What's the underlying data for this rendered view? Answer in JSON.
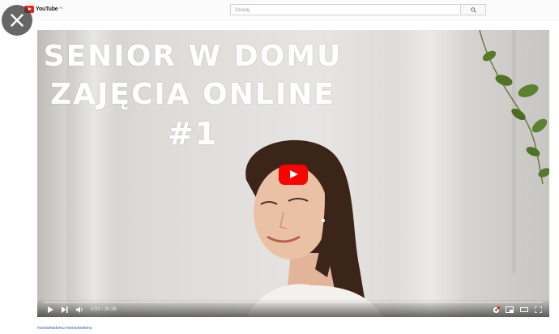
{
  "header": {
    "logo_text": "YouTube",
    "logo_sup": "PL",
    "search_placeholder": "Szukaj",
    "logo_color": "#e62117"
  },
  "video": {
    "title_lines": [
      "SENIOR W DOMU",
      "ZAJĘCIA ONLINE",
      "#1"
    ],
    "time": "0:00 / 30:38",
    "progress": 0.0,
    "play_button_color": "#ff0000"
  },
  "below_video": {
    "hashtags": "#zostańwdomu #seniorwdomu"
  },
  "icons": {
    "close": "close-icon",
    "search": "search-icon",
    "play": "play-icon",
    "next": "next-icon",
    "volume": "volume-icon",
    "settings": "settings-icon",
    "miniplayer": "miniplayer-icon",
    "theater": "theater-icon",
    "fullscreen": "fullscreen-icon"
  }
}
